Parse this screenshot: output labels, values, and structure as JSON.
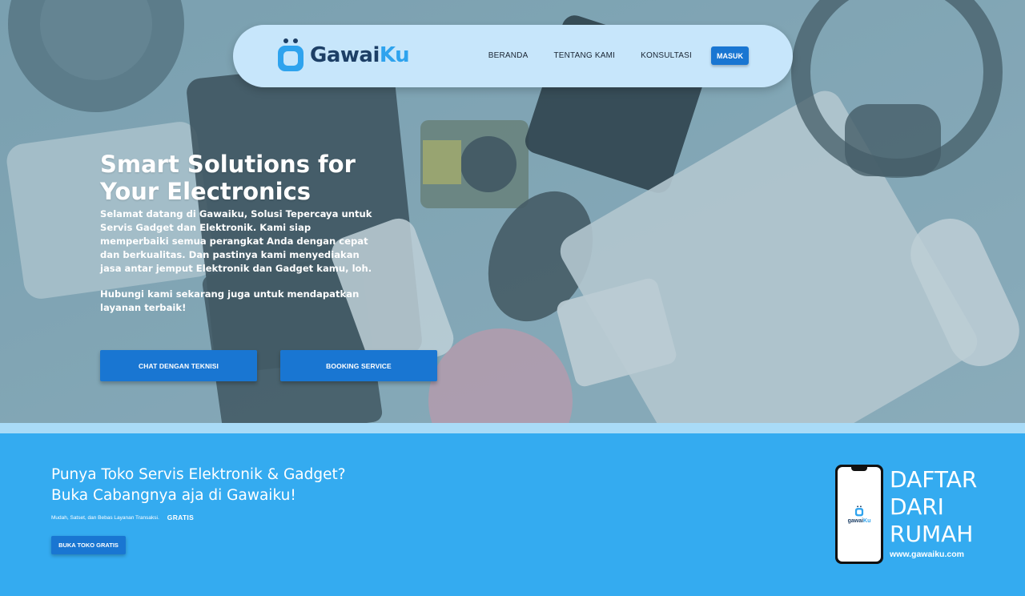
{
  "brand": {
    "name_part1": "Gawai",
    "name_part2": "Ku",
    "color_dark": "#1d3f66",
    "color_accent": "#2ea3ee"
  },
  "nav": {
    "items": [
      {
        "label": "BERANDA"
      },
      {
        "label": "TENTANG KAMI"
      },
      {
        "label": "KONSULTASI"
      }
    ],
    "login_label": "MASUK"
  },
  "hero": {
    "title": "Smart Solutions for Your Electronics",
    "description": "Selamat datang di Gawaiku, Solusi Tepercaya untuk Servis Gadget dan Elektronik. Kami siap memperbaiki semua perangkat Anda dengan cepat dan berkualitas. Dan pastinya kami menyediakan jasa antar jemput Elektronik dan Gadget kamu, loh.",
    "cta_text": "Hubungi kami sekarang juga untuk mendapatkan layanan terbaik!",
    "chat_button": "CHAT DENGAN TEKNISI",
    "booking_button": "BOOKING SERVICE",
    "background_icon": "electronics-desk-photo"
  },
  "promo": {
    "title_line1": "Punya Toko Servis Elektronik & Gadget?",
    "title_line2": "Buka Cabangnya aja di Gawaiku!",
    "subtitle": "Mudah, Satset, dan Bebas Layanan Transaksi.",
    "free_label": "GRATIS",
    "button": "BUKA TOKO GRATIS",
    "phone_logo_part1": "gawai",
    "phone_logo_part2": "Ku",
    "daftar_line1": "DAFTAR",
    "daftar_line2": "DARI",
    "daftar_line3": "RUMAH",
    "url": "www.gawaiku.com"
  },
  "colors": {
    "primary_button": "#1976d2",
    "navbar_bg": "#c7e6fb",
    "promo_bg": "#34abf0",
    "strip": "#a9dbf7"
  }
}
